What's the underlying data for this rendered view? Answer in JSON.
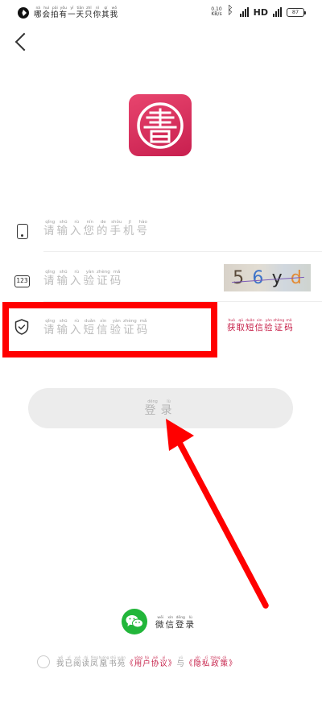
{
  "status_bar": {
    "title": [
      "哪",
      "会",
      "拍",
      "有",
      "一",
      "天",
      "只",
      "你",
      "其",
      "我"
    ],
    "title_pinyin": [
      "nǎ",
      "huì",
      "pāi",
      "yǒu",
      "yī",
      "tiān",
      "zhǐ",
      "nǐ",
      "qí",
      "wǒ"
    ],
    "net_speed_value": "0.10",
    "net_speed_unit": "KB/s",
    "network": "HD",
    "battery": "87"
  },
  "phone_field": {
    "placeholder": [
      "请",
      "输",
      "入",
      "您",
      "的",
      "手",
      "机",
      "号"
    ],
    "placeholder_pinyin": [
      "qǐng",
      "shū",
      "rù",
      "nín",
      "de",
      "shǒu",
      "jī",
      "hào"
    ],
    "icon": "phone-icon"
  },
  "captcha_field": {
    "icon_text": "123",
    "placeholder": [
      "请",
      "输",
      "入",
      "验",
      "证",
      "码"
    ],
    "placeholder_pinyin": [
      "qǐng",
      "shū",
      "rù",
      "yàn",
      "zhèng",
      "mǎ"
    ],
    "captcha_chars": [
      "5",
      "6",
      "y",
      "d"
    ],
    "captcha_colors": [
      "#5a4a3a",
      "#3e74c8",
      "#2b2b2b",
      "#e38b35"
    ]
  },
  "sms_field": {
    "placeholder": [
      "请",
      "输",
      "入",
      "短",
      "信",
      "验",
      "证",
      "码"
    ],
    "placeholder_pinyin": [
      "qǐng",
      "shū",
      "rù",
      "duǎn",
      "xìn",
      "yàn",
      "zhèng",
      "mǎ"
    ],
    "icon": "shield-icon",
    "get_code": [
      "获",
      "取",
      "短",
      "信",
      "验",
      "证",
      "码"
    ],
    "get_code_pinyin": [
      "huò",
      "qǔ",
      "duǎn",
      "xìn",
      "yàn",
      "zhèng",
      "mǎ"
    ]
  },
  "login_button": {
    "label": [
      "登",
      "录"
    ],
    "label_pinyin": [
      "dēng",
      "lù"
    ]
  },
  "wechat_login": {
    "label": [
      "微",
      "信",
      "登",
      "录"
    ],
    "label_pinyin": [
      "wēi",
      "xìn",
      "dēng",
      "lù"
    ]
  },
  "agreement": {
    "prefix": [
      "我",
      "已",
      "阅",
      "读",
      "凤",
      "凰",
      "书",
      "苑"
    ],
    "prefix_pinyin": [
      "wǒ",
      "yǐ",
      "yuè",
      "dú",
      "fèng",
      "huáng",
      "shū",
      "yuàn"
    ],
    "user_agreement": [
      "《",
      "用",
      "户",
      "协",
      "议",
      "》"
    ],
    "user_agreement_pinyin": [
      "",
      "yòng",
      "hù",
      "xié",
      "yì",
      ""
    ],
    "conjunction": [
      "与"
    ],
    "conjunction_pinyin": [
      "yǔ"
    ],
    "privacy_policy": [
      "《",
      "隐",
      "私",
      "政",
      "策",
      "》"
    ],
    "privacy_policy_pinyin": [
      "",
      "yǐn",
      "sī",
      "zhèng",
      "cè",
      ""
    ]
  },
  "colors": {
    "brand": "#c81f4f",
    "highlight": "#ff0000",
    "wechat": "#22b63a"
  }
}
